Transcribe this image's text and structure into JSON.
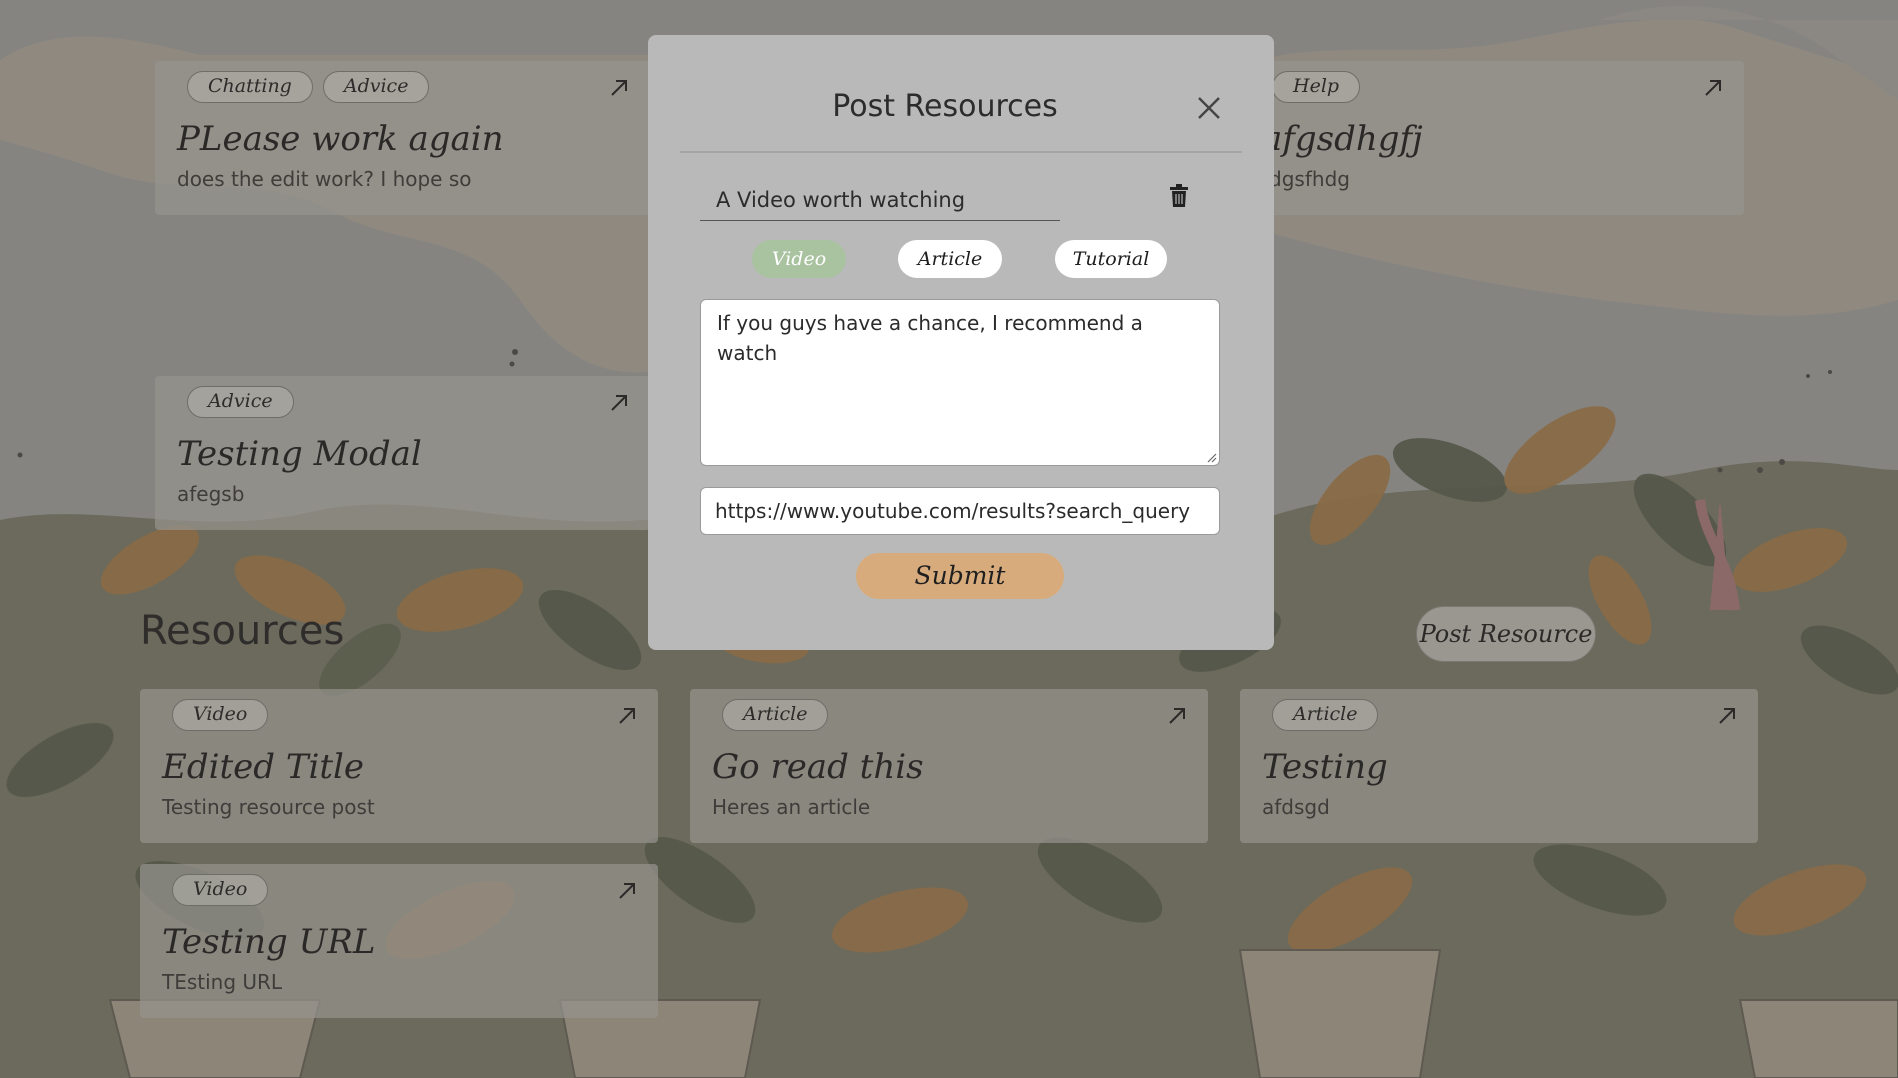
{
  "colors": {
    "overlay": "#8c8a86",
    "modal_bg": "#b9b9b9",
    "accent_video": "#a9c2a0",
    "submit_bg": "#d8ab7c"
  },
  "forum_cards": [
    {
      "tags": [
        "Chatting",
        "Advice"
      ],
      "title": "PLease work again",
      "description": "does the edit work? I hope so"
    },
    {
      "tags": [
        "Help"
      ],
      "title": "afgsdhgfj",
      "description": "fdgsfhdg"
    },
    {
      "tags": [
        "Advice"
      ],
      "title": "Testing Modal",
      "description": "afegsb"
    }
  ],
  "resources": {
    "heading": "Resources",
    "post_button": "Post Resource",
    "cards": [
      {
        "tag": "Video",
        "title": "Edited Title",
        "description": "Testing resource post"
      },
      {
        "tag": "Article",
        "title": "Go read this",
        "description": "Heres an article"
      },
      {
        "tag": "Article",
        "title": "Testing",
        "description": "afdsgd"
      },
      {
        "tag": "Video",
        "title": "Testing URL",
        "description": "TEsting URL"
      }
    ]
  },
  "modal": {
    "title": "Post Resources",
    "title_value": "A Video worth watching",
    "types": [
      "Video",
      "Article",
      "Tutorial"
    ],
    "selected_type": "Video",
    "description_value": "If you guys have a chance, I recommend a watch",
    "url_value": "https://www.youtube.com/results?search_query",
    "submit_label": "Submit",
    "icons": {
      "close": "close-icon",
      "delete": "trash-icon",
      "open": "arrow-up-right-icon"
    }
  }
}
